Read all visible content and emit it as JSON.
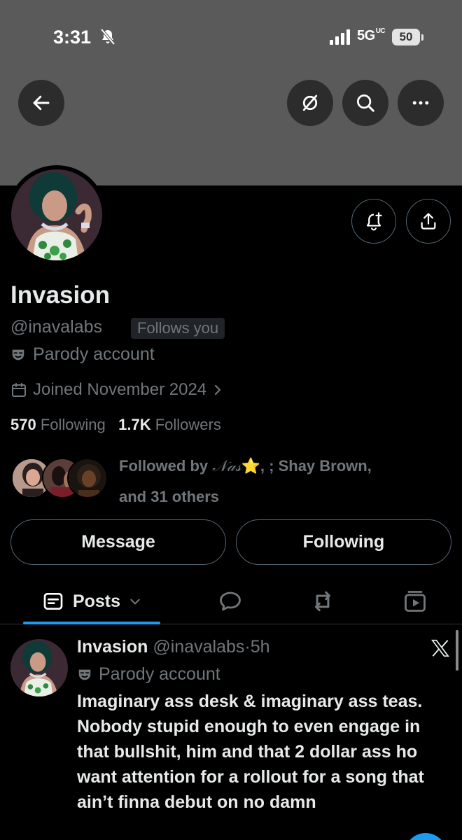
{
  "status_bar": {
    "time": "3:31",
    "network": "5G",
    "network_sub": "UC",
    "battery": "50"
  },
  "header": {
    "back_icon": "arrow-left-icon",
    "grok_icon": "grok-icon",
    "search_icon": "search-icon",
    "more_icon": "more-icon"
  },
  "profile": {
    "name": "Invasion",
    "handle": "@inavalabs",
    "follows_you": "Follows you",
    "parody_label": "Parody account",
    "joined": "Joined November 2024",
    "following_count": "570",
    "following_label": "Following",
    "followers_count": "1.7K",
    "followers_label": "Followers",
    "followed_by_prefix": "Followed by",
    "followed_by_nas": "𝒩𝒶𝓈",
    "followed_by_star": "⭐",
    "followed_by_rest": ",   ; Shay Brown,",
    "followed_by_others": "and 31 others"
  },
  "actions": {
    "message": "Message",
    "following": "Following"
  },
  "tabs": {
    "posts": "Posts"
  },
  "post": {
    "name": "Invasion",
    "handle": "@inavalabs",
    "separator": "·",
    "time": "5h",
    "parody_label": "Parody account",
    "text": "Imaginary ass desk & imaginary ass teas.\nNobody stupid enough to even engage in that bullshit, him and that 2 dollar ass ho want attention for a rollout for a song that ain’t finna debut on no damn"
  },
  "colors": {
    "accent": "#1d9bf0",
    "banner": "#5a5a5a",
    "muted": "#71767b",
    "border": "#536471"
  }
}
